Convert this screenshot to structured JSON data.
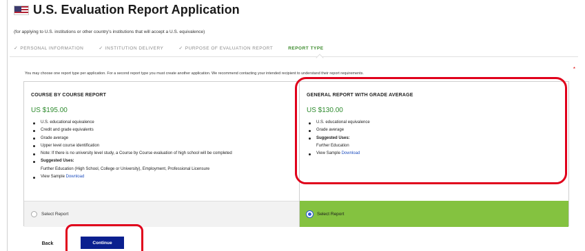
{
  "header": {
    "flag_icon": "us-flag-icon",
    "title": "U.S. Evaluation Report Application",
    "subtitle": "(for applying to U.S. institutions or other country's institutions that will accept a U.S. equivalence)"
  },
  "steps": [
    {
      "label": "PERSONAL INFORMATION",
      "completed": true
    },
    {
      "label": "INSTITUTION DELIVERY",
      "completed": true
    },
    {
      "label": "PURPOSE OF EVALUATION REPORT",
      "completed": true
    },
    {
      "label": "REPORT TYPE",
      "active": true
    }
  ],
  "check_glyph": "✓",
  "info_text": "You may choose one report type per application. For a second report type you must create another application. We recommend contacting your intended recipient to understand their report requirements.",
  "required_marker": "*",
  "cards": [
    {
      "title": "COURSE BY COURSE REPORT",
      "price": "US $195.00",
      "features": [
        "U.S. educational equivalence",
        "Credit and grade equivalents",
        "Grade average",
        "Upper level course identification",
        "Note: If there is no university level study, a Course by Course evaluation of high school will be completed"
      ],
      "suggested_label": "Suggested Uses:",
      "suggested_text": "Further Education (High School, College or University), Employment, Professional Licensure",
      "sample_label": "View Sample",
      "download_label": "Download",
      "select_label": "Select Report",
      "selected": false
    },
    {
      "title": "GENERAL REPORT WITH GRADE AVERAGE",
      "price": "US $130.00",
      "features": [
        "U.S. educational equivalence",
        "Grade average"
      ],
      "suggested_label": "Suggested Uses:",
      "suggested_text": "Further Education",
      "sample_label": "View Sample",
      "download_label": "Download",
      "select_label": "Select Report",
      "selected": true
    }
  ],
  "buttons": {
    "back": "Back",
    "continue": "Continue"
  },
  "colors": {
    "price_green": "#2e8b2e",
    "selected_bar": "#84c240",
    "continue_bg": "#0a1f8f",
    "link_blue": "#1f4fbf",
    "highlight_red": "#e0001b"
  }
}
